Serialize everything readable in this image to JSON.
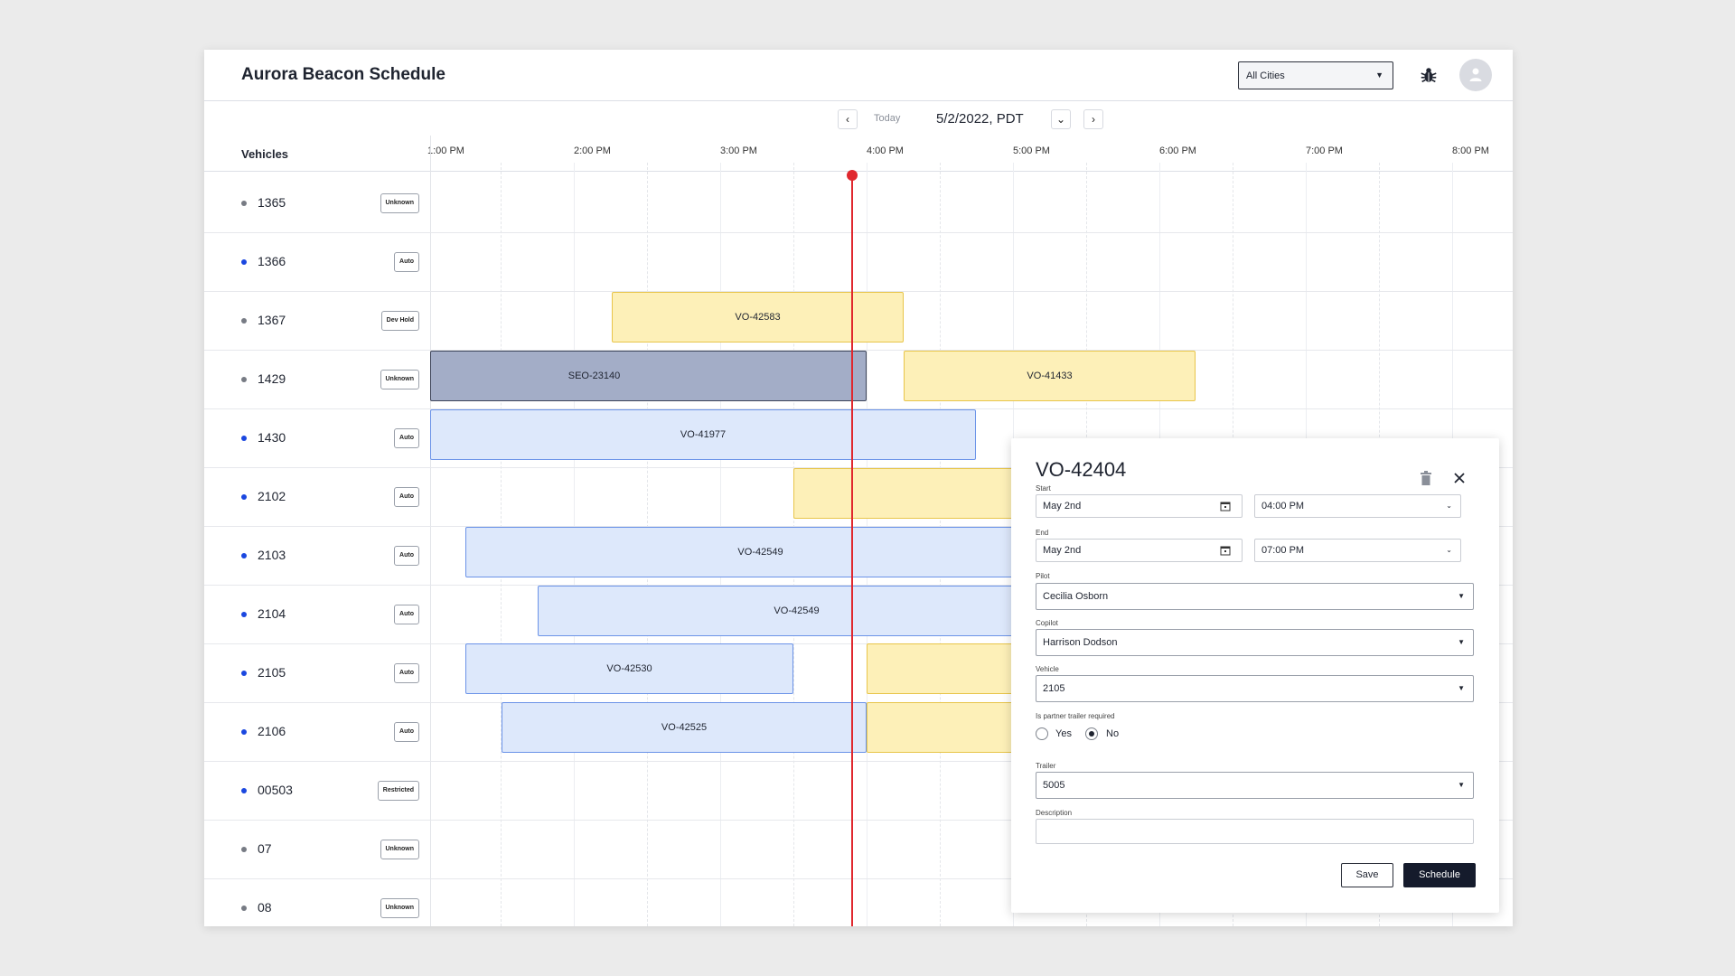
{
  "app": {
    "title": "Aurora Beacon Schedule"
  },
  "header": {
    "city_filter": "All Cities",
    "bug_icon": "bug-icon",
    "avatar_icon": "user-icon"
  },
  "date_nav": {
    "today_label": "Today",
    "date": "5/2/2022, PDT"
  },
  "grid": {
    "vehicles_heading": "Vehicles",
    "time_ticks": [
      "1:00 PM",
      "2:00 PM",
      "3:00 PM",
      "4:00 PM",
      "5:00 PM",
      "6:00 PM",
      "7:00 PM",
      "8:00 PM"
    ]
  },
  "colors": {
    "active_dot": "#1a47e0",
    "inactive_dot": "#777b84",
    "now_line": "#e0282e",
    "yellow_block": "#fdf0b8",
    "blue_block": "#dde8fb",
    "gray_block": "#a3adc7"
  },
  "vehicles": [
    {
      "id": "1365",
      "status": "Unknown",
      "active": false
    },
    {
      "id": "1366",
      "status": "Auto",
      "active": true
    },
    {
      "id": "1367",
      "status": "Dev Hold",
      "active": false
    },
    {
      "id": "1429",
      "status": "Unknown",
      "active": false
    },
    {
      "id": "1430",
      "status": "Auto",
      "active": true
    },
    {
      "id": "2102",
      "status": "Auto",
      "active": true
    },
    {
      "id": "2103",
      "status": "Auto",
      "active": true
    },
    {
      "id": "2104",
      "status": "Auto",
      "active": true
    },
    {
      "id": "2105",
      "status": "Auto",
      "active": true
    },
    {
      "id": "2106",
      "status": "Auto",
      "active": true
    },
    {
      "id": "00503",
      "status": "Restricted",
      "active": true
    },
    {
      "id": "07",
      "status": "Unknown",
      "active": false
    },
    {
      "id": "08",
      "status": "Unknown",
      "active": false
    }
  ],
  "blocks": [
    {
      "label": "VO-42583"
    },
    {
      "label": "SEO-23140"
    },
    {
      "label": "VO-41433"
    },
    {
      "label": "VO-41977"
    },
    {
      "label": ""
    },
    {
      "label": "VO-42549"
    },
    {
      "label": "VO-42549"
    },
    {
      "label": "VO-42530"
    },
    {
      "label": ""
    },
    {
      "label": "VO-42525"
    },
    {
      "label": ""
    }
  ],
  "popover": {
    "title": "VO-42404",
    "start_label": "Start",
    "start_date": "May 2nd",
    "start_time": "04:00 PM",
    "end_label": "End",
    "end_date": "May 2nd",
    "end_time": "07:00 PM",
    "pilot_label": "Pilot",
    "pilot": "Cecilia Osborn",
    "copilot_label": "Copilot",
    "copilot": "Harrison Dodson",
    "vehicle_label": "Vehicle",
    "vehicle": "2105",
    "trailer_question": "Is partner trailer required",
    "yes_label": "Yes",
    "no_label": "No",
    "trailer_label": "Trailer",
    "trailer": "5005",
    "description_label": "Description",
    "description": "",
    "save_label": "Save",
    "schedule_label": "Schedule"
  }
}
